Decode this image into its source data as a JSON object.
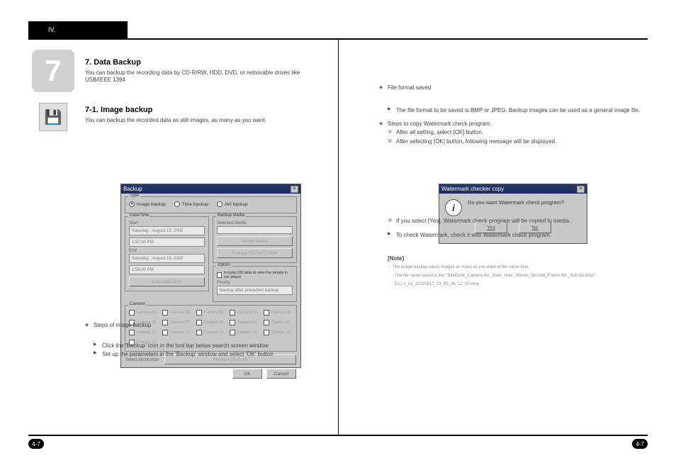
{
  "header": {
    "tab": "IV."
  },
  "chapter": "7",
  "page_num": "4-7",
  "left": {
    "h_data": "7. Data Backup",
    "p_data": "You can backup the recording data by CD-R/RW, HDD, DVD, or removable drives like USB/IEEE 1394",
    "h_image": "7-1. Image backup",
    "p_image": "You can backup the recorded data as still images, as many as you want.",
    "star1": "Steps of image backup",
    "arr1": "Click the 'Backup' icon in the tool bar below search screen window",
    "arr2": "Set up the parameters in the 'Backup' window and select 'OK' button"
  },
  "right": {
    "star1": "File format saved",
    "arr1": "The file format to be saved is BMP or JPEG. Backup images can be used as a general image file.",
    "star2": "Steps to copy Watermark check program",
    "num1": "After all setting, select [OK] button.",
    "num2": "After selecting [OK] button, following message will be displayed.",
    "num3": "If you select [Yes], Watermark check program will be copied to media.",
    "arr3": "To check Watermark, check it with Watermark check program.",
    "note_label": "[Note]",
    "note1": "☞ The image backup saves images as many as you want at the same time.",
    "note2": "The file name saved is like \"SiteCode_Camera No._Date_Hour_Minute_Second_Frame No._Sub No.bmp\".",
    "note3": "Ex.) 0_01_20020617_15_00_06_12_00.bmp"
  },
  "backup_dlg": {
    "title": "Backup",
    "type": {
      "label": "Type",
      "image": "Image backup",
      "time": "Time backup",
      "avi": "AVI backup"
    },
    "datetime": {
      "label": "Date/Time",
      "start": "Start",
      "end": "End",
      "date": "Saturday ,  August    10, 2002",
      "time1": "1:57:00 PM",
      "time2": "1:58:00 PM",
      "calc": "Calculate Size"
    },
    "media": {
      "label": "Backup Media",
      "selected": "Selected Media",
      "select_btn": "Select media",
      "format_btn": "Format CD-R/CD-RW"
    },
    "option": {
      "label": "Option",
      "include": "Include DB data to view the details in our player",
      "priority": "Priority",
      "priority_val": "Backup after precedent backup"
    },
    "camera": {
      "label": "Camera",
      "items": [
        "Camera 01",
        "Camera 02",
        "Camera 03",
        "Camera 04",
        "Camera 05",
        "Camera 06",
        "Camera 07",
        "Camera 08",
        "Camera 09",
        "Camera 10",
        "Camera 11",
        "Camera 12",
        "Camera 13",
        "Camera 14",
        "Camera 15",
        "Camera 16"
      ]
    },
    "dest": {
      "label": "Select destination",
      "mediaA": "Media A (default)"
    },
    "ok": "OK",
    "cancel": "Cancel"
  },
  "wm_dlg": {
    "title": "Watermark checker copy",
    "msg": "Do you want Watermark check program?",
    "yes": "Yes",
    "no": "No"
  }
}
